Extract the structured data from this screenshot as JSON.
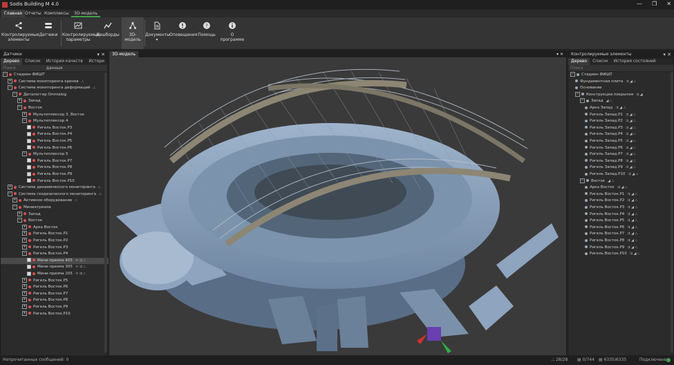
{
  "window": {
    "title": "Sodis Building M 4.0",
    "controls": [
      "—",
      "❐",
      "✕"
    ]
  },
  "menu": {
    "tabs": [
      "Главная",
      "Отчеты",
      "Комплексы",
      "3D-модель"
    ]
  },
  "ribbon": {
    "buttons": [
      {
        "label1": "Контролируемые",
        "label2": "элементы",
        "icon": "share-icon"
      },
      {
        "label1": "Датчики",
        "label2": "",
        "icon": "sensors-icon"
      },
      {
        "label1": "Контролируемые",
        "label2": "параметры",
        "icon": "params-icon"
      },
      {
        "label1": "Дэшборды",
        "label2": "",
        "icon": "dashboard-icon"
      },
      {
        "label1": "3D-модель",
        "label2": "",
        "icon": "model-icon"
      },
      {
        "label1": "Документы",
        "label2": "▾",
        "icon": "document-icon"
      },
      {
        "label1": "Оповещения",
        "label2": "",
        "icon": "alert-icon"
      },
      {
        "label1": "Помощь",
        "label2": "",
        "icon": "help-icon"
      },
      {
        "label1": "О программе",
        "label2": "",
        "icon": "info-icon"
      }
    ]
  },
  "left_panel": {
    "title": "Датчики",
    "close": "✕",
    "pin": "▾",
    "tabs": [
      "Дерево",
      "Список",
      "История качеств данных",
      "Истори"
    ],
    "search_placeholder": "Поиск",
    "rows": [
      {
        "indent": 0,
        "exp": "-",
        "text": "Стадион ФИШТ",
        "dot": true
      },
      {
        "indent": 1,
        "exp": "+",
        "text": "Система мониторинга кренов",
        "dot": true,
        "acts": "⛬"
      },
      {
        "indent": 1,
        "exp": "-",
        "text": "Система мониторинга деформаций",
        "dot": true,
        "acts": "⛬"
      },
      {
        "indent": 2,
        "exp": "-",
        "text": "Даталоггер Omnialog",
        "dot": true
      },
      {
        "indent": 3,
        "exp": "+",
        "text": "Запад",
        "dot": true
      },
      {
        "indent": 3,
        "exp": "-",
        "text": "Восток",
        "dot": true
      },
      {
        "indent": 4,
        "exp": "+",
        "text": "Мультиплексор 3. Восток",
        "dot": true
      },
      {
        "indent": 4,
        "exp": "-",
        "text": "Мультиплексор 4",
        "dot": true
      },
      {
        "indent": 5,
        "cb": true,
        "text": "Ригель Восток.Р3",
        "dot": true
      },
      {
        "indent": 5,
        "cb": true,
        "text": "Ригель Восток.Р4",
        "dot": true
      },
      {
        "indent": 5,
        "cb": true,
        "text": "Ригель Восток.Р5",
        "dot": true
      },
      {
        "indent": 5,
        "cb": true,
        "text": "Ригель Восток.Р6",
        "dot": true
      },
      {
        "indent": 4,
        "exp": "-",
        "text": "Мультиплексор 5",
        "dot": true
      },
      {
        "indent": 5,
        "cb": true,
        "text": "Ригель Восток.Р7",
        "dot": true
      },
      {
        "indent": 5,
        "cb": true,
        "text": "Ригель Восток.Р8",
        "dot": true
      },
      {
        "indent": 5,
        "cb": true,
        "text": "Ригель Восток.Р9",
        "dot": true
      },
      {
        "indent": 5,
        "cb": true,
        "text": "Ригель Восток.Р10",
        "dot": true
      },
      {
        "indent": 1,
        "exp": "+",
        "text": "Система динамического мониторинга",
        "dot": true,
        "acts": "⛬"
      },
      {
        "indent": 1,
        "exp": "-",
        "text": "Система геодезического мониторинга",
        "dot": true,
        "acts": "⛬"
      },
      {
        "indent": 2,
        "exp": "+",
        "text": "Активное оборудование",
        "dot": true,
        "acts": "⛬"
      },
      {
        "indent": 2,
        "exp": "-",
        "text": "Миниатризма",
        "dot": true
      },
      {
        "indent": 3,
        "exp": "+",
        "text": "Запад",
        "dot": true
      },
      {
        "indent": 3,
        "exp": "-",
        "text": "Восток",
        "dot": true
      },
      {
        "indent": 4,
        "exp": "+",
        "text": "Арка Восток",
        "dot": true
      },
      {
        "indent": 4,
        "exp": "+",
        "text": "Ригель Восток.Р1",
        "dot": true
      },
      {
        "indent": 4,
        "exp": "+",
        "text": "Ригель Восток.Р2",
        "dot": true
      },
      {
        "indent": 4,
        "exp": "+",
        "text": "Ригель Восток.Р3",
        "dot": true
      },
      {
        "indent": 4,
        "exp": "-",
        "text": "Ригель Восток.Р4",
        "dot": true
      },
      {
        "indent": 5,
        "cb": true,
        "text": "Мини-призма 405",
        "dot": true,
        "acts": "⋖ ⇉ ⛬",
        "sel": true
      },
      {
        "indent": 5,
        "cb": true,
        "text": "Мини-призма 305",
        "dot": true,
        "acts": "⋖ ⇉ ⛬"
      },
      {
        "indent": 5,
        "cb": true,
        "text": "Мини-призма 205",
        "dot": true,
        "acts": "⋖ ⇉ ⛬"
      },
      {
        "indent": 4,
        "exp": "+",
        "text": "Ригель Восток.Р5",
        "dot": true
      },
      {
        "indent": 4,
        "exp": "+",
        "text": "Ригель Восток.Р6",
        "dot": true
      },
      {
        "indent": 4,
        "exp": "+",
        "text": "Ригель Восток.Р7",
        "dot": true
      },
      {
        "indent": 4,
        "exp": "+",
        "text": "Ригель Восток.Р8",
        "dot": true
      },
      {
        "indent": 4,
        "exp": "+",
        "text": "Ригель Восток.Р9",
        "dot": true
      },
      {
        "indent": 4,
        "exp": "+",
        "text": "Ригель Восток.Р10",
        "dot": true
      }
    ]
  },
  "viewport": {
    "tab": "3D-модель",
    "close": "✕",
    "pin": "▾"
  },
  "right_panel": {
    "title": "Контролируемые элементы",
    "close": "✕",
    "pin": "▾",
    "tabs": [
      "Дерево",
      "Список",
      "История состояний"
    ],
    "search_placeholder": "Поиск",
    "rows": [
      {
        "indent": 0,
        "exp": "-",
        "text": "Стадион ФИШТ",
        "acts": ""
      },
      {
        "indent": 1,
        "text": "Фундаментная плита",
        "acts": "⇉ ◢ ⛬"
      },
      {
        "indent": 1,
        "text": "Основание",
        "acts": ""
      },
      {
        "indent": 1,
        "exp": "-",
        "text": "Конструкции покрытия",
        "acts": "⇉ ◢"
      },
      {
        "indent": 2,
        "exp": "-",
        "text": "Запад",
        "acts": "◢ ⛬"
      },
      {
        "indent": 3,
        "text": "Арка Запад",
        "acts": "⇉ ◢ ⛬"
      },
      {
        "indent": 3,
        "text": "Ригель Запад.Р1",
        "acts": "⇉ ◢ ⛬"
      },
      {
        "indent": 3,
        "text": "Ригель Запад.Р2",
        "acts": "⇉ ◢ ⛬"
      },
      {
        "indent": 3,
        "text": "Ригель Запад.Р3",
        "acts": "⇉ ◢ ⛬"
      },
      {
        "indent": 3,
        "text": "Ригель Запад.Р4",
        "acts": "⇉ ◢ ⛬"
      },
      {
        "indent": 3,
        "text": "Ригель Запад.Р5",
        "acts": "⇉ ◢ ⛬"
      },
      {
        "indent": 3,
        "text": "Ригель Запад.Р6",
        "acts": "⇉ ◢ ⛬"
      },
      {
        "indent": 3,
        "text": "Ригель Запад.Р7",
        "acts": "⇉ ◢ ⛬"
      },
      {
        "indent": 3,
        "text": "Ригель Запад.Р8",
        "acts": "⇉ ◢ ⛬"
      },
      {
        "indent": 3,
        "text": "Ригель Запад.Р9",
        "acts": "⇉ ◢ ⛬"
      },
      {
        "indent": 3,
        "text": "Ригель Запад.Р10",
        "acts": "⇉ ◢ ⛬"
      },
      {
        "indent": 2,
        "exp": "-",
        "text": "Восток",
        "acts": "◢ ⛬"
      },
      {
        "indent": 3,
        "text": "Арка Восток",
        "acts": "⇉ ◢ ⛬"
      },
      {
        "indent": 3,
        "text": "Ригель Восток.Р1",
        "acts": "⇉ ◢ ⛬"
      },
      {
        "indent": 3,
        "text": "Ригель Восток.Р2",
        "acts": "⇉ ◢ ⛬"
      },
      {
        "indent": 3,
        "text": "Ригель Восток.Р3",
        "acts": "⇉ ◢ ⛬"
      },
      {
        "indent": 3,
        "text": "Ригель Восток.Р4",
        "acts": "⇉ ◢ ⛬"
      },
      {
        "indent": 3,
        "text": "Ригель Восток.Р5",
        "acts": "⇉ ◢ ⛬"
      },
      {
        "indent": 3,
        "text": "Ригель Восток.Р6",
        "acts": "⇉ ◢ ⛬"
      },
      {
        "indent": 3,
        "text": "Ригель Восток.Р7",
        "acts": "⇉ ◢ ⛬"
      },
      {
        "indent": 3,
        "text": "Ригель Восток.Р8",
        "acts": "⇉ ◢ ⛬"
      },
      {
        "indent": 3,
        "text": "Ригель Восток.Р9",
        "acts": "⇉ ◢ ⛬"
      },
      {
        "indent": 3,
        "text": "Ригель Восток.Р10",
        "acts": "⇉ ◢ ⛬"
      }
    ]
  },
  "status": {
    "left": "Непрочитанных сообщений: 0",
    "c1": "28/28",
    "c2": "0/744",
    "c3": "6335/6335",
    "conn": "Подключено"
  },
  "colors": {
    "alarm": "#e05050",
    "accent": "#3fa04a",
    "bg": "#2b2b2b"
  }
}
